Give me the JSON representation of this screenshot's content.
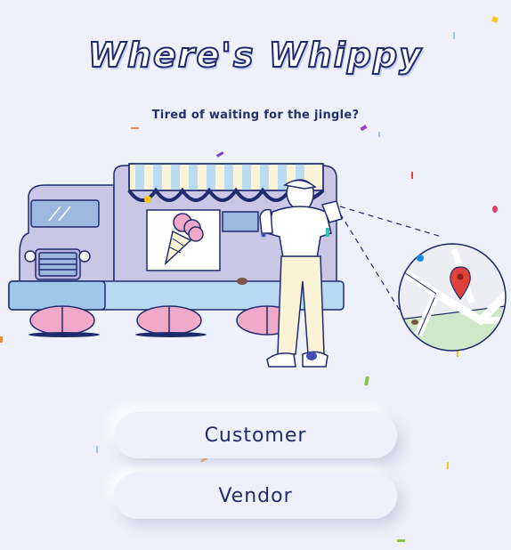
{
  "header": {
    "title": "Where's Whippy",
    "tagline": "Tired of waiting for the jingle?"
  },
  "roles": {
    "customer_label": "Customer",
    "vendor_label": "Vendor"
  },
  "colors": {
    "background": "#eef1fa",
    "ink": "#1f2b6e",
    "truck_body": "#c9c6e6",
    "truck_base": "#b7d9f2",
    "wheels": "#f0a9c9",
    "awning_stripe": "#b9dcf4",
    "map_pin": "#e0413a",
    "map_park": "#cfe8c9"
  },
  "illustration": {
    "icons": [
      "ice-cream-truck-icon",
      "ice-cream-cone-icon",
      "vendor-person-icon",
      "map-location-icon",
      "map-pin-icon"
    ]
  }
}
